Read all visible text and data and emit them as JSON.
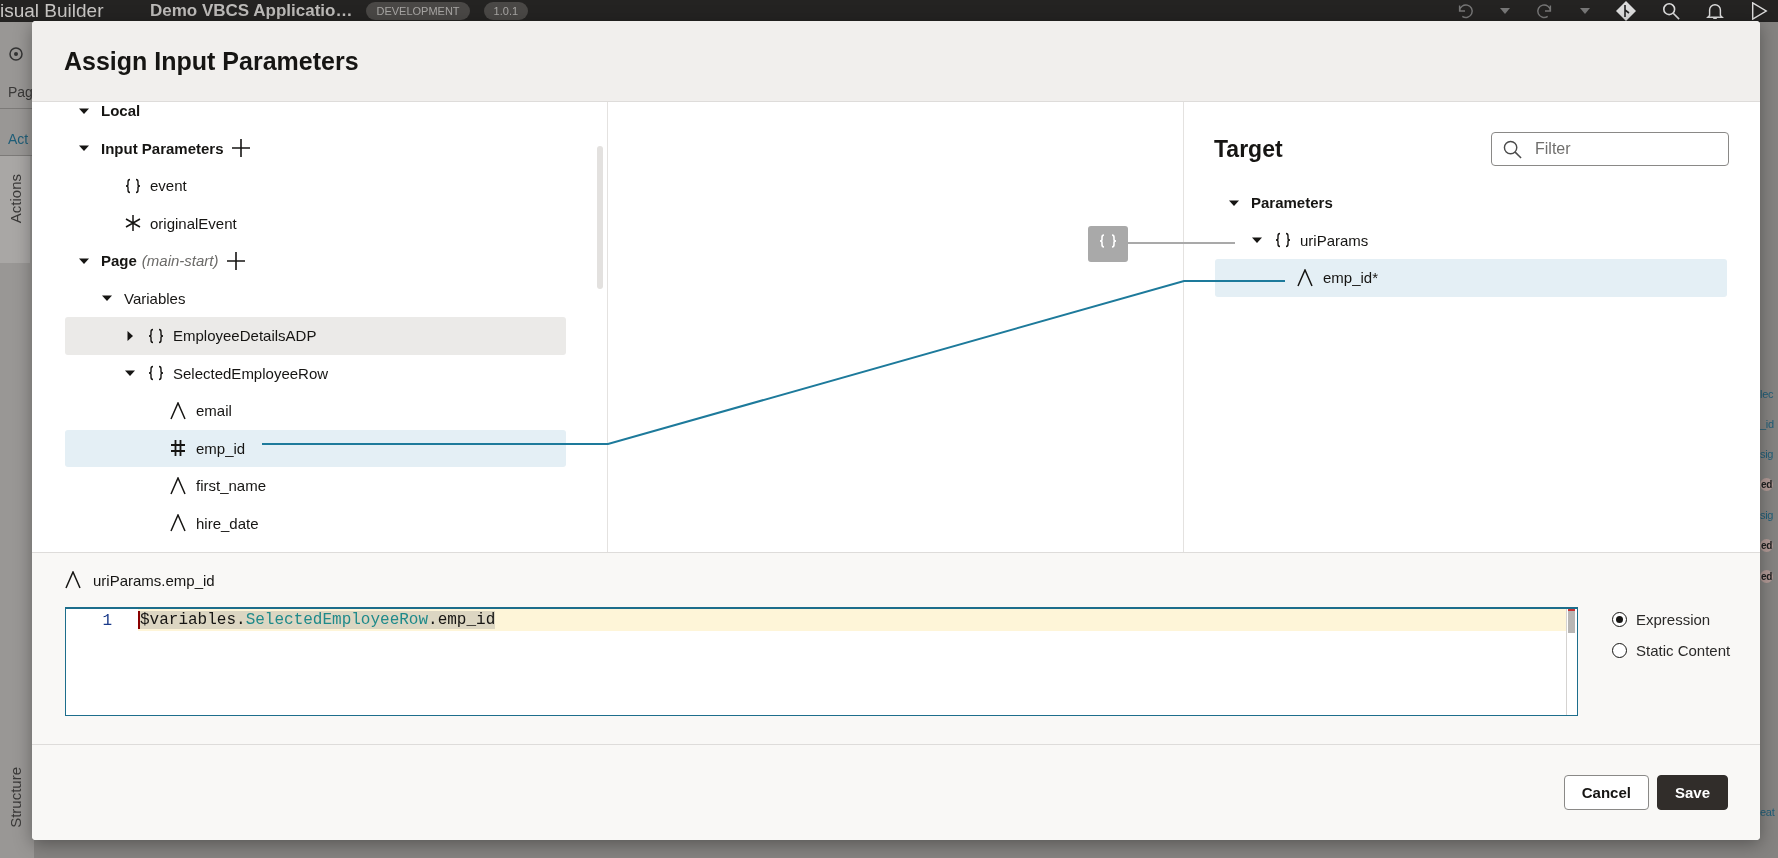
{
  "app": {
    "product": "isual Builder",
    "application": "Demo VBCS Applicatio…",
    "badges": [
      "DEVELOPMENT",
      "1.0.1"
    ],
    "left_rail": {
      "tabs": [
        {
          "label": "Pag",
          "selected": false
        },
        {
          "label": "Act",
          "selected": true
        }
      ],
      "side_tabs": [
        "Actions",
        "Structure"
      ]
    },
    "right_fragments": [
      {
        "text": "lec",
        "kind": "link"
      },
      {
        "text": "_id",
        "kind": "link"
      },
      {
        "text": "sig",
        "kind": "link"
      },
      {
        "text": "ed",
        "kind": "badge"
      },
      {
        "text": "sig",
        "kind": "link"
      },
      {
        "text": "ed",
        "kind": "badge"
      },
      {
        "text": "ed",
        "kind": "badge"
      },
      {
        "text": "eat",
        "kind": "link"
      }
    ]
  },
  "dialog": {
    "title": "Assign Input Parameters",
    "source_tree": [
      {
        "label": "Local",
        "kind": "section",
        "expanded": true,
        "selected": false,
        "hovered": false
      },
      {
        "label": "Input Parameters",
        "kind": "section",
        "expanded": true,
        "addable": true,
        "selected": false,
        "hovered": false,
        "children": [
          {
            "label": "event",
            "kind": "object",
            "selected": false,
            "hovered": false
          },
          {
            "label": "originalEvent",
            "kind": "any",
            "selected": false,
            "hovered": false
          }
        ]
      },
      {
        "label": "Page",
        "scope": "(main-start)",
        "kind": "section",
        "expanded": true,
        "addable": true,
        "selected": false,
        "hovered": false,
        "children": [
          {
            "label": "Variables",
            "kind": "folder",
            "expanded": true,
            "selected": false,
            "hovered": false,
            "children": [
              {
                "label": "EmployeeDetailsADP",
                "kind": "object",
                "expanded": false,
                "selected": false,
                "hovered": true
              },
              {
                "label": "SelectedEmployeeRow",
                "kind": "object",
                "expanded": true,
                "selected": false,
                "hovered": false,
                "children": [
                  {
                    "label": "email",
                    "kind": "string",
                    "selected": false,
                    "hovered": false
                  },
                  {
                    "label": "emp_id",
                    "kind": "number",
                    "selected": true,
                    "hovered": false
                  },
                  {
                    "label": "first_name",
                    "kind": "string",
                    "selected": false,
                    "hovered": false
                  },
                  {
                    "label": "hire_date",
                    "kind": "string",
                    "selected": false,
                    "hovered": false
                  }
                ]
              }
            ]
          }
        ]
      }
    ],
    "target": {
      "title": "Target",
      "filter": {
        "placeholder": "Filter"
      },
      "tree": [
        {
          "label": "Parameters",
          "kind": "section",
          "expanded": true,
          "selected": false,
          "hovered": false,
          "children": [
            {
              "label": "uriParams",
              "kind": "object",
              "expanded": true,
              "selected": false,
              "hovered": false,
              "children": [
                {
                  "label": "emp_id*",
                  "kind": "string",
                  "selected": true,
                  "hovered": false
                }
              ]
            }
          ]
        }
      ]
    },
    "expression": {
      "target_path": "uriParams.emp_id",
      "line_number": "1",
      "tokens": [
        {
          "text": "$variables.",
          "kind": "plain"
        },
        {
          "text": "SelectedEmployeeRow",
          "kind": "property"
        },
        {
          "text": ".emp_id",
          "kind": "plain"
        }
      ]
    },
    "modes": [
      {
        "label": "Expression",
        "selected": true
      },
      {
        "label": "Static Content",
        "selected": false
      }
    ],
    "buttons": [
      {
        "label": "Cancel",
        "kind": "secondary"
      },
      {
        "label": "Save",
        "kind": "primary"
      }
    ]
  }
}
